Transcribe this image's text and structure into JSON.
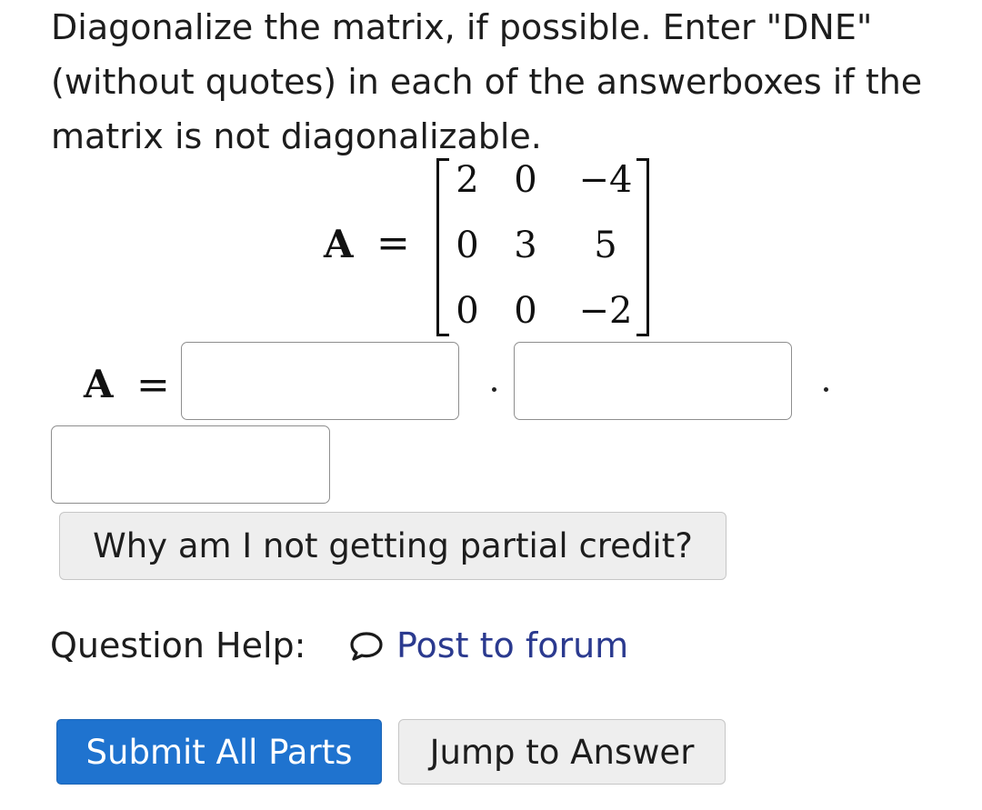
{
  "question": {
    "prompt": "Diagonalize the matrix, if possible. Enter \"DNE\" (without quotes) in each of the answerboxes if the matrix is not diagonalizable."
  },
  "matrix": {
    "label": "A",
    "equals": "=",
    "rows": [
      [
        "2",
        "0",
        "−4"
      ],
      [
        "0",
        "3",
        "5"
      ],
      [
        "0",
        "0",
        "−2"
      ]
    ]
  },
  "answer": {
    "label": "A",
    "equals": "=",
    "box1_value": "",
    "box2_value": "",
    "box3_value": ""
  },
  "buttons": {
    "partial_credit": "Why am I not getting partial credit?",
    "submit_all": "Submit All Parts",
    "jump_to_answer": "Jump to Answer"
  },
  "help": {
    "label": "Question Help:",
    "forum_link": "Post to forum",
    "forum_icon": "speech-bubble-icon"
  },
  "colors": {
    "link": "#2b3a8f",
    "primary_button": "#1f73cf",
    "secondary_button": "#eeeeee"
  }
}
